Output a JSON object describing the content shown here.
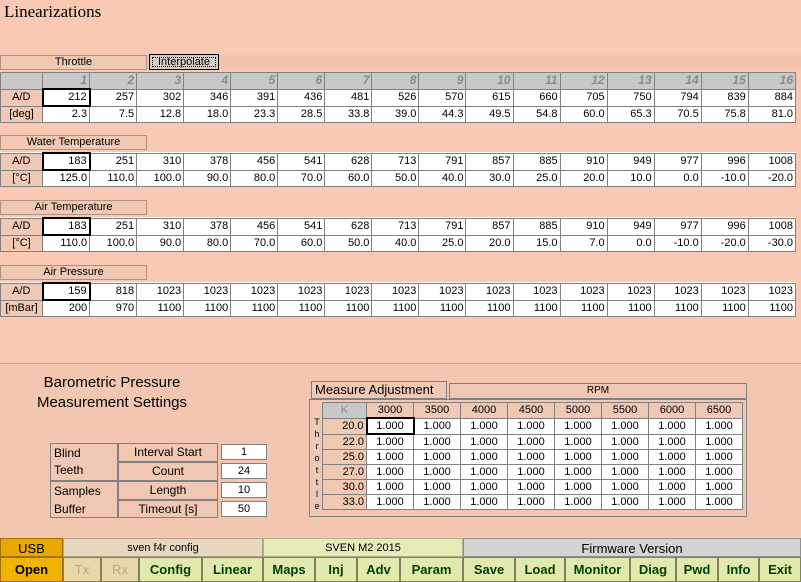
{
  "window_title": "Linearizations",
  "throttle": {
    "label": "Throttle",
    "interpolate_label": "Interpolate",
    "columns": [
      "1",
      "2",
      "3",
      "4",
      "5",
      "6",
      "7",
      "8",
      "9",
      "10",
      "11",
      "12",
      "13",
      "14",
      "15",
      "16"
    ],
    "row1_label": "A/D",
    "row1": [
      "212",
      "257",
      "302",
      "346",
      "391",
      "436",
      "481",
      "526",
      "570",
      "615",
      "660",
      "705",
      "750",
      "794",
      "839",
      "884"
    ],
    "row2_label": "[deg]",
    "row2": [
      "2.3",
      "7.5",
      "12.8",
      "18.0",
      "23.3",
      "28.5",
      "33.8",
      "39.0",
      "44.3",
      "49.5",
      "54.8",
      "60.0",
      "65.3",
      "70.5",
      "75.8",
      "81.0"
    ]
  },
  "water": {
    "label": "Water Temperature",
    "row1_label": "A/D",
    "row1": [
      "183",
      "251",
      "310",
      "378",
      "456",
      "541",
      "628",
      "713",
      "791",
      "857",
      "885",
      "910",
      "949",
      "977",
      "996",
      "1008"
    ],
    "row2_label": "[°C]",
    "row2": [
      "125.0",
      "110.0",
      "100.0",
      "90.0",
      "80.0",
      "70.0",
      "60.0",
      "50.0",
      "40.0",
      "30.0",
      "25.0",
      "20.0",
      "10.0",
      "0.0",
      "-10.0",
      "-20.0"
    ]
  },
  "air": {
    "label": "Air Temperature",
    "row1_label": "A/D",
    "row1": [
      "183",
      "251",
      "310",
      "378",
      "456",
      "541",
      "628",
      "713",
      "791",
      "857",
      "885",
      "910",
      "949",
      "977",
      "996",
      "1008"
    ],
    "row2_label": "[°C]",
    "row2": [
      "110.0",
      "100.0",
      "90.0",
      "80.0",
      "70.0",
      "60.0",
      "50.0",
      "40.0",
      "25.0",
      "20.0",
      "15.0",
      "7.0",
      "0.0",
      "-10.0",
      "-20.0",
      "-30.0"
    ]
  },
  "pressure": {
    "label": "Air Pressure",
    "row1_label": "A/D",
    "row1": [
      "159",
      "818",
      "1023",
      "1023",
      "1023",
      "1023",
      "1023",
      "1023",
      "1023",
      "1023",
      "1023",
      "1023",
      "1023",
      "1023",
      "1023",
      "1023"
    ],
    "row2_label": "[mBar]",
    "row2": [
      "200",
      "970",
      "1100",
      "1100",
      "1100",
      "1100",
      "1100",
      "1100",
      "1100",
      "1100",
      "1100",
      "1100",
      "1100",
      "1100",
      "1100",
      "1100"
    ]
  },
  "baro": {
    "title_line1": "Barometric Pressure",
    "title_line2": "Measurement Settings",
    "blind_label": "Blind",
    "teeth_label": "Teeth",
    "samples_label": "Samples",
    "buffer_label": "Buffer",
    "interval_start_label": "Interval Start",
    "interval_start_value": "1",
    "count_label": "Count",
    "count_value": "24",
    "length_label": "Length",
    "length_value": "10",
    "timeout_label": "Timeout [s]",
    "timeout_value": "50"
  },
  "measure_adjustment": {
    "title": "Measure Adjustment",
    "rpm_label": "RPM",
    "corner_label": "K",
    "throttle_vertical": "Throttle",
    "rpm_columns": [
      "3000",
      "3500",
      "4000",
      "4500",
      "5000",
      "5500",
      "6000",
      "6500"
    ],
    "rows": [
      {
        "throttle": "20.0",
        "values": [
          "1.000",
          "1.000",
          "1.000",
          "1.000",
          "1.000",
          "1.000",
          "1.000",
          "1.000"
        ]
      },
      {
        "throttle": "22.0",
        "values": [
          "1.000",
          "1.000",
          "1.000",
          "1.000",
          "1.000",
          "1.000",
          "1.000",
          "1.000"
        ]
      },
      {
        "throttle": "25.0",
        "values": [
          "1.000",
          "1.000",
          "1.000",
          "1.000",
          "1.000",
          "1.000",
          "1.000",
          "1.000"
        ]
      },
      {
        "throttle": "27.0",
        "values": [
          "1.000",
          "1.000",
          "1.000",
          "1.000",
          "1.000",
          "1.000",
          "1.000",
          "1.000"
        ]
      },
      {
        "throttle": "30.0",
        "values": [
          "1.000",
          "1.000",
          "1.000",
          "1.000",
          "1.000",
          "1.000",
          "1.000",
          "1.000"
        ]
      },
      {
        "throttle": "33.0",
        "values": [
          "1.000",
          "1.000",
          "1.000",
          "1.000",
          "1.000",
          "1.000",
          "1.000",
          "1.000"
        ]
      }
    ]
  },
  "status": {
    "usb_label": "USB",
    "config_name": "sven f4r config",
    "firmware_name": "SVEN M2 2015",
    "firmware_version_label": "Firmware Version"
  },
  "buttons": {
    "open": "Open",
    "tx": "Tx",
    "rx": "Rx",
    "config": "Config",
    "linear": "Linear",
    "maps": "Maps",
    "inj": "Inj",
    "adv": "Adv",
    "param": "Param",
    "save": "Save",
    "load": "Load",
    "monitor": "Monitor",
    "diag": "Diag",
    "pwd": "Pwd",
    "info": "Info",
    "exit": "Exit"
  },
  "colors": {
    "background": "#f9c9b3",
    "usb_orange": "#e8a800",
    "open_orange": "#f0b400",
    "button_green": "#e1e9ad",
    "header_gray": "#c8c8c8"
  }
}
